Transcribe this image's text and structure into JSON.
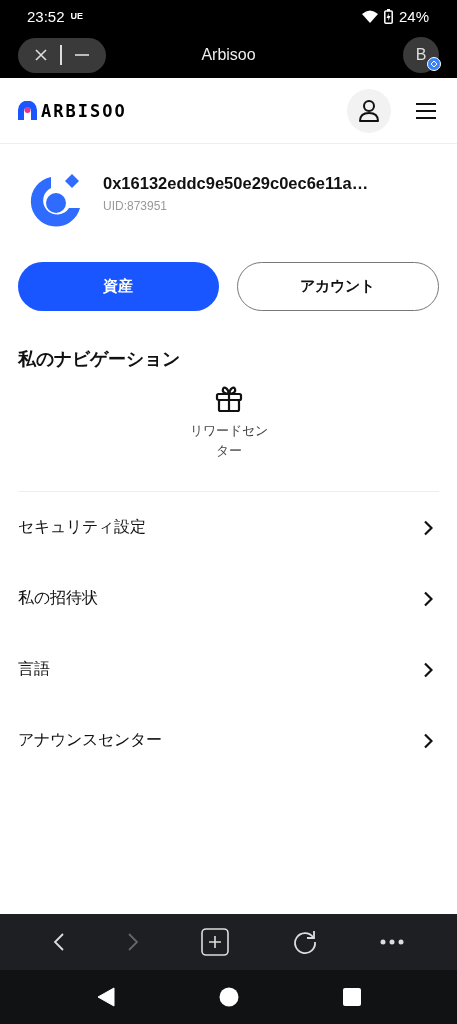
{
  "status_bar": {
    "time": "23:52",
    "carrier": "UE",
    "battery": "24%"
  },
  "browser_bar": {
    "title": "Arbisoo",
    "avatar": "B"
  },
  "header": {
    "logo": "ARBISOO"
  },
  "profile": {
    "address": "0x16132eddc9e50e29c0ec6e11a…",
    "uid": "UID:873951"
  },
  "buttons": [
    {
      "label": "資産",
      "kind": "primary"
    },
    {
      "label": "アカウント",
      "kind": "outline"
    }
  ],
  "navigation": {
    "title": "私のナビゲーション",
    "items": [
      {
        "label": "リワードセンター"
      }
    ]
  },
  "menu": [
    {
      "label": "セキュリティ設定"
    },
    {
      "label": "私の招待状"
    },
    {
      "label": "言語"
    },
    {
      "label": "アナウンスセンター"
    }
  ],
  "toolbar": {
    "back_disabled": false,
    "forward_disabled": true
  }
}
